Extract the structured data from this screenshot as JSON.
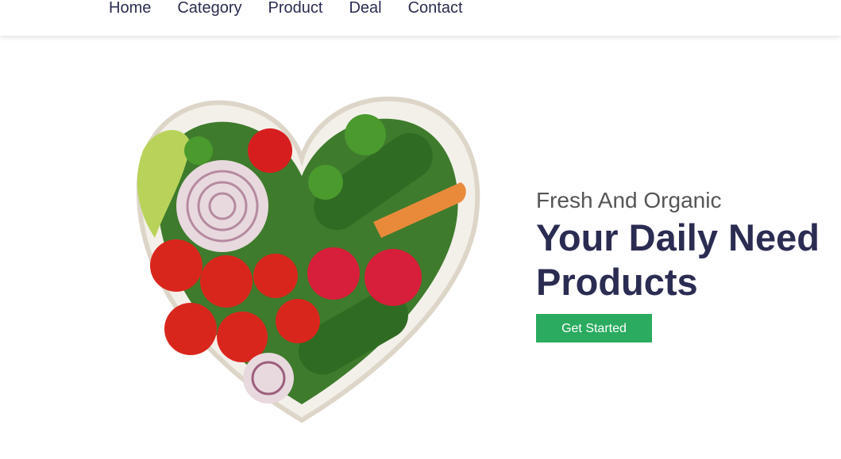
{
  "nav": {
    "items": [
      "Home",
      "Category",
      "Product",
      "Deal",
      "Contact"
    ]
  },
  "hero": {
    "subtitle": "Fresh And Organic",
    "title_line1": "Your Daily Need",
    "title_line2": "Products",
    "cta_label": "Get Started"
  },
  "colors": {
    "accent": "#2aab5f",
    "heading": "#2b2c52",
    "subtitle": "#555555"
  },
  "image": {
    "icon": "heart-vegetable-bowl"
  }
}
